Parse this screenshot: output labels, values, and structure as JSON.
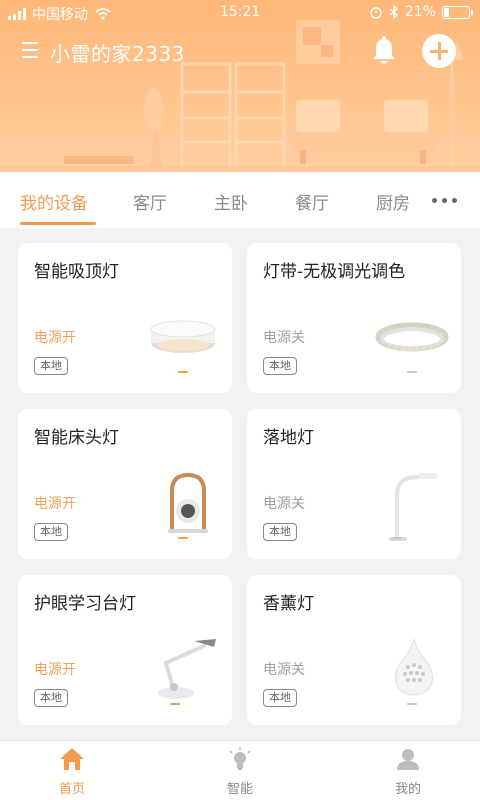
{
  "status_bar": {
    "carrier": "中国移动",
    "time": "15:21",
    "battery": "21%",
    "battery_level": 0.21
  },
  "header": {
    "title": "小雷的家2333"
  },
  "tabs": [
    {
      "label": "我的设备",
      "active": true
    },
    {
      "label": "客厅",
      "active": false
    },
    {
      "label": "主卧",
      "active": false
    },
    {
      "label": "餐厅",
      "active": false
    },
    {
      "label": "厨房",
      "active": false
    }
  ],
  "devices": [
    {
      "name": "智能吸顶灯",
      "power": "电源开",
      "on": true,
      "tag": "本地",
      "icon": "ceiling-light-icon"
    },
    {
      "name": "灯带-无极调光调色",
      "power": "电源关",
      "on": false,
      "tag": "本地",
      "icon": "light-strip-icon"
    },
    {
      "name": "智能床头灯",
      "power": "电源开",
      "on": true,
      "tag": "本地",
      "icon": "bedside-lamp-icon"
    },
    {
      "name": "落地灯",
      "power": "电源关",
      "on": false,
      "tag": "本地",
      "icon": "floor-lamp-icon"
    },
    {
      "name": "护眼学习台灯",
      "power": "电源开",
      "on": true,
      "tag": "本地",
      "icon": "desk-lamp-icon"
    },
    {
      "name": "香薰灯",
      "power": "电源关",
      "on": false,
      "tag": "本地",
      "icon": "aroma-lamp-icon"
    }
  ],
  "bottom_nav": [
    {
      "label": "首页",
      "icon": "home-icon",
      "active": true
    },
    {
      "label": "智能",
      "icon": "bulb-icon",
      "active": false
    },
    {
      "label": "我的",
      "icon": "profile-icon",
      "active": false
    }
  ],
  "colors": {
    "accent": "#f59a4d",
    "header_bg": "#ffbd82",
    "power_on": "#f7a05a",
    "power_off": "#a0a0a0"
  }
}
